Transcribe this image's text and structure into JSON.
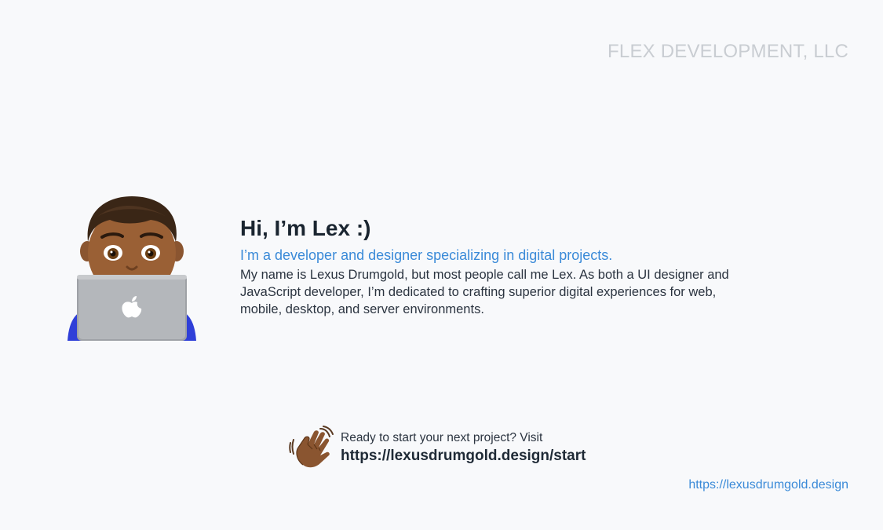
{
  "header": {
    "company": "FLEX DEVELOPMENT, LLC"
  },
  "avatar": {
    "icon": "man-technologist-emoji"
  },
  "intro": {
    "title": "Hi, I’m Lex :)",
    "tagline": "I’m a developer and designer specializing in digital projects.",
    "bio": "My name is Lexus Drumgold, but most people call me Lex. As both a UI designer and JavaScript developer, I’m dedicated to crafting superior digital experiences for web, mobile, desktop, and server environments."
  },
  "cta": {
    "icon": "waving-hand-emoji",
    "line1": "Ready to start your next project? Visit",
    "link": "https://lexusdrumgold.design/start"
  },
  "footer": {
    "link": "https://lexusdrumgold.design"
  },
  "colors": {
    "background": "#f8f9fb",
    "accent": "#3a8ad8",
    "heading": "#1a2530",
    "muted": "#c9cdd2"
  }
}
